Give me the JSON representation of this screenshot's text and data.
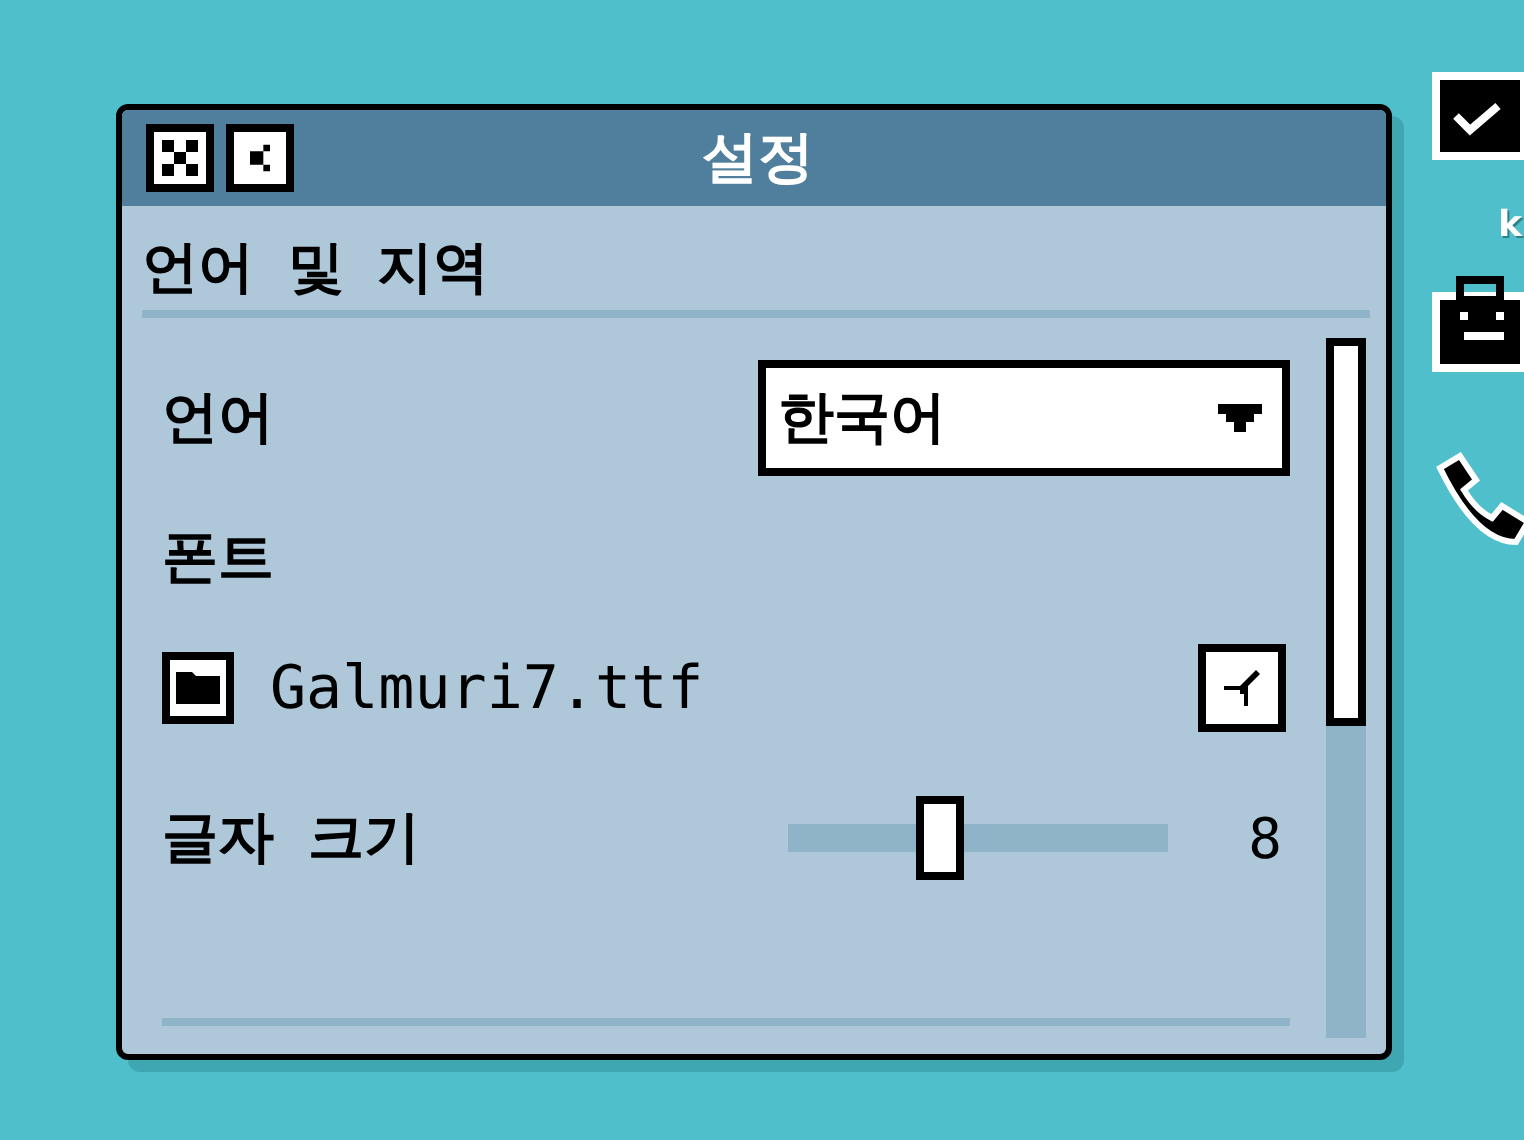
{
  "window": {
    "title": "설정",
    "controls": [
      {
        "kind": "close"
      },
      {
        "kind": "minimize"
      }
    ]
  },
  "section": {
    "title": "언어 및 지역"
  },
  "language": {
    "label": "언어",
    "value": "한국어"
  },
  "font": {
    "label": "폰트",
    "file": "Galmuri7.ttf"
  },
  "font_size": {
    "label": "글자 크기",
    "level": 0.4,
    "value": "8"
  },
  "desktop_icons": [
    {
      "kind": "monitor",
      "label": "k"
    },
    {
      "kind": "bag"
    },
    {
      "kind": "phone"
    }
  ]
}
